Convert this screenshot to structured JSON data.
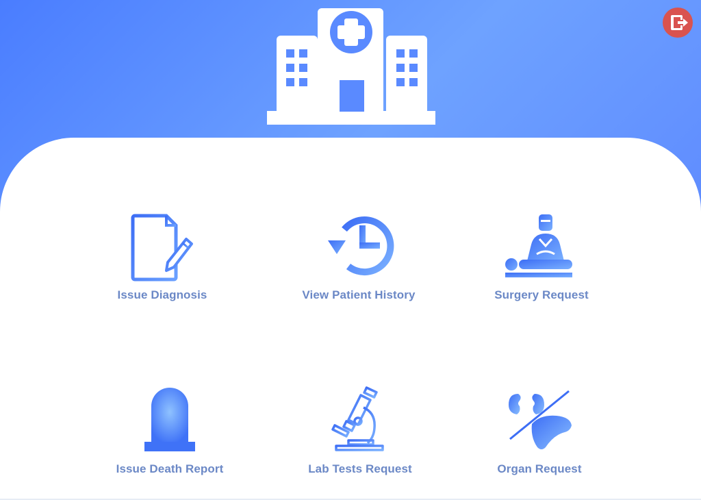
{
  "header": {
    "logo_icon": "hospital-icon",
    "logout_icon": "logout-icon",
    "accent_color": "#4a7dff",
    "logout_color": "#d9534f"
  },
  "menu": {
    "items": [
      {
        "label": "Issue Diagnosis",
        "icon": "document-pencil-icon"
      },
      {
        "label": "View Patient History",
        "icon": "history-icon"
      },
      {
        "label": "Surgery Request",
        "icon": "surgeon-icon"
      },
      {
        "label": "Issue Death Report",
        "icon": "tombstone-icon"
      },
      {
        "label": "Lab Tests Request",
        "icon": "microscope-icon"
      },
      {
        "label": "Organ Request",
        "icon": "organs-icon"
      }
    ],
    "label_color": "#6b88c6"
  }
}
